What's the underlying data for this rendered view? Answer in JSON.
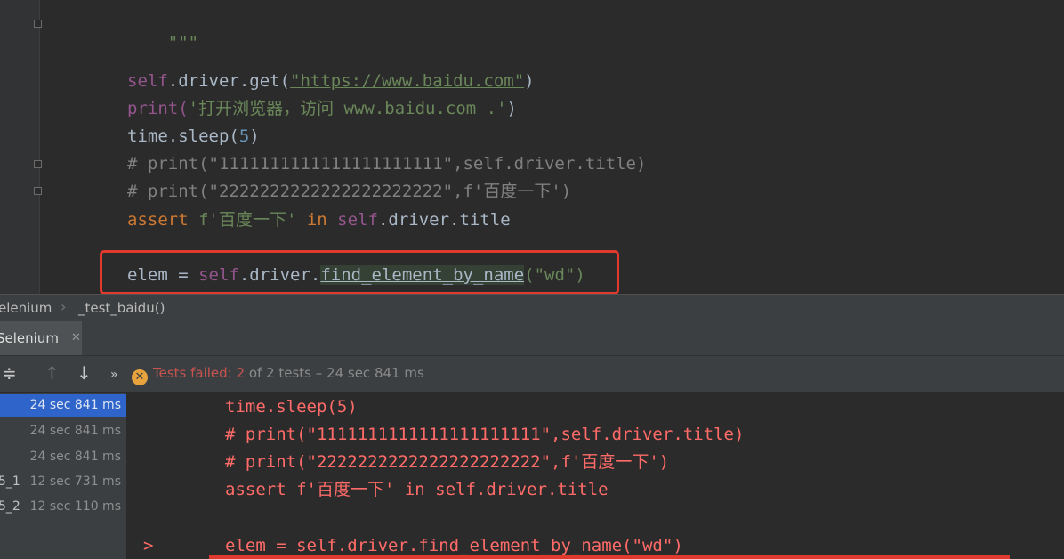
{
  "editor": {
    "lines": [
      {
        "id": "docstring_end",
        "text": "\"\"\""
      },
      {
        "id": "get",
        "self": "self",
        "rest": ".driver.get(",
        "arg": "\"https://www.baidu.com\"",
        "close": ")"
      },
      {
        "id": "print1",
        "fn": "print(",
        "arg": "'打开浏览器，访问 www.baidu.com .'",
        "close": ")"
      },
      {
        "id": "sleep",
        "fn": "time.sleep(",
        "num": "5",
        "close": ")"
      },
      {
        "id": "cmt1",
        "text": "# print(\"1111111111111111111111\",self.driver.title)"
      },
      {
        "id": "cmt2",
        "text": "# print(\"2222222222222222222222\",f'百度一下')"
      },
      {
        "id": "assert",
        "kw": "assert ",
        "str": "f'百度一下'",
        "in": " in ",
        "self": "self",
        "rest": ".driver.title"
      },
      {
        "id": "elem",
        "pre": "elem = ",
        "self": "self",
        "mid": ".driver.",
        "method": "find_element_by_name",
        "arg": "(\"wd\")",
        "close": ")"
      }
    ]
  },
  "breadcrumb": {
    "items": [
      "elenium",
      "_test_baidu()"
    ]
  },
  "run_panel": {
    "tab_label": "Selenium",
    "status": {
      "failed": "Tests failed: ",
      "count": "2",
      "rest": " of 2 tests – 24 sec 841 ms"
    },
    "tree": [
      {
        "name": "",
        "time": "24 sec 841 ms",
        "selected": true
      },
      {
        "name": "",
        "time": "24 sec 841 ms",
        "selected": false
      },
      {
        "name": "",
        "time": "24 sec 841 ms",
        "selected": false
      },
      {
        "name": "5_1",
        "time": "12 sec 731 ms",
        "selected": false
      },
      {
        "name": "5_2",
        "time": "12 sec 110 ms",
        "selected": false
      }
    ],
    "console": [
      "time.sleep(5)",
      "# print(\"1111111111111111111111\",self.driver.title)",
      "# print(\"2222222222222222222222\",f'百度一下')",
      "assert f'百度一下' in self.driver.title",
      "elem = self.driver.find_element_by_name(\"wd\")"
    ],
    "prompt": ">"
  },
  "colors": {
    "accent_red": "#e03a2f",
    "error_text": "#ff6b68",
    "selection": "#2f65ca"
  }
}
